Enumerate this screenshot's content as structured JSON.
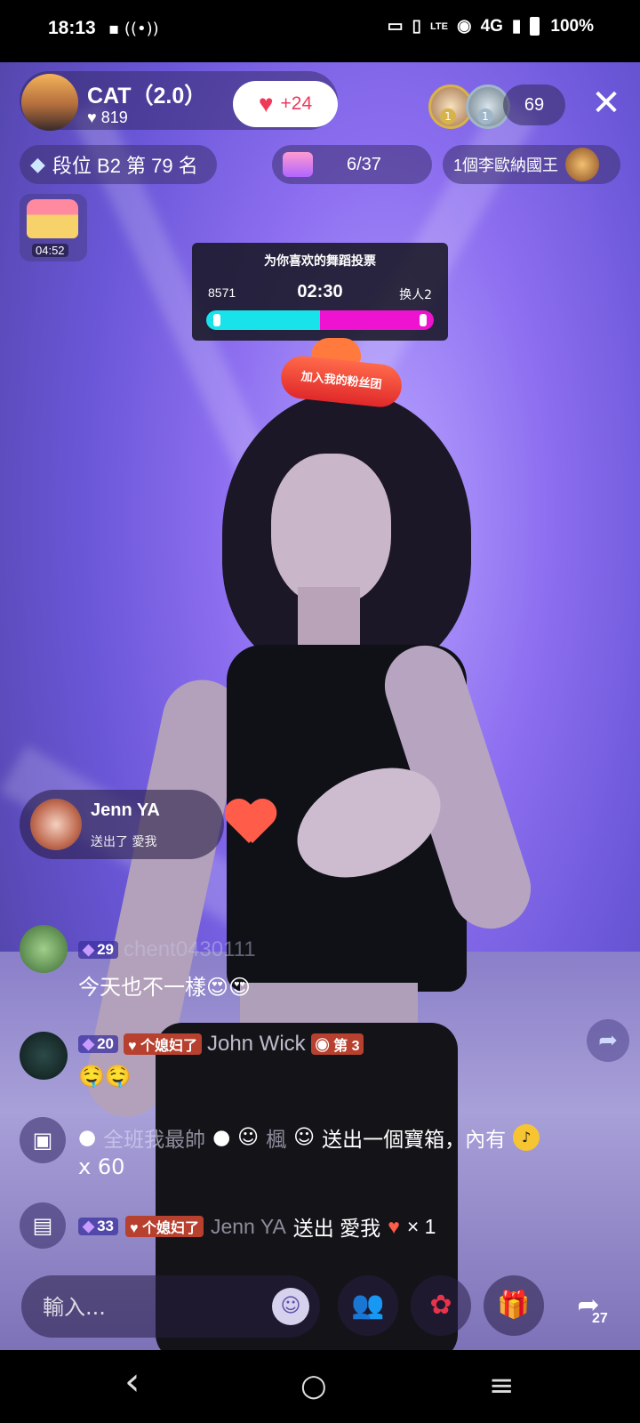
{
  "status_bar": {
    "time": "18:13",
    "left_icons": "▪ ((•))",
    "network": "4G",
    "volte": "LTE",
    "battery": "100%"
  },
  "host": {
    "name": "CAT（2.0）",
    "likes": "819",
    "follow_label": "+24"
  },
  "viewers": {
    "top1_rank": "1",
    "top2_rank": "1",
    "count": "69"
  },
  "rank": {
    "label": "段位 B2 第 79 名"
  },
  "progress": {
    "label": "6/37"
  },
  "king": {
    "label": "1個李歐納國王"
  },
  "treasure": {
    "timer": "04:52"
  },
  "vote": {
    "title": "为你喜欢的舞蹈投票",
    "left_score": "8571",
    "timer": "02:30",
    "right_label": "换人2",
    "left_fraction": 0.5
  },
  "fan_club": {
    "label": "加入我的粉丝团"
  },
  "gift_notification": {
    "user": "Jenn YA",
    "action": "送出了 愛我"
  },
  "chat": [
    {
      "level": "29",
      "username": "chent0430111",
      "message": "今天也不一樣😍😍"
    },
    {
      "level": "20",
      "fan_badge": "个媳妇了",
      "username": "John Wick",
      "rank_badge": "第 3",
      "message": "🤤🤤"
    }
  ],
  "system_messages": [
    {
      "sender": "全班我最帥",
      "sender2": "楓",
      "text": "送出一個寶箱，內有",
      "count": "x 60"
    },
    {
      "level": "33",
      "fan_badge": "个媳妇了",
      "username": "Jenn YA",
      "text": "送出 愛我",
      "count": "× 1"
    }
  ],
  "bottom_bar": {
    "input_placeholder": "輸入...",
    "share_count": "27"
  },
  "nav": {
    "back": "‹",
    "home": "○",
    "recents": "≡"
  }
}
